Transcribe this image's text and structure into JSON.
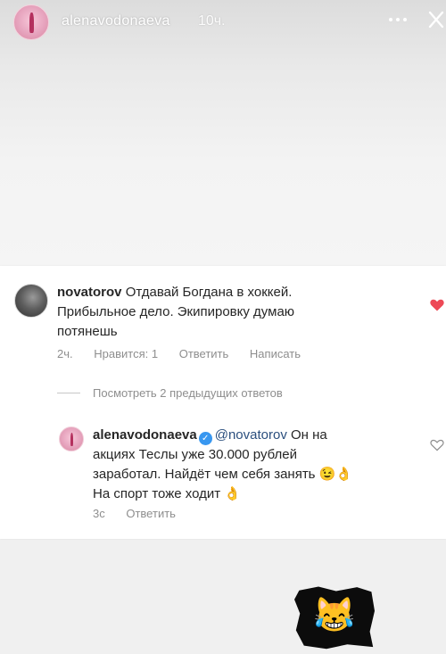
{
  "story": {
    "username": "alenavodonaeva",
    "time": "10ч.",
    "more_icon": "more-dots-icon",
    "close_icon": "close-icon"
  },
  "comment": {
    "username": "novatorov",
    "text_line1": "Отдавай Богдана в хоккей.",
    "text_line2": "Прибыльное дело. Экипировку думаю",
    "text_line3": "потянешь",
    "time": "2ч.",
    "likes": "Нравится: 1",
    "reply": "Ответить",
    "message": "Написать",
    "liked": true
  },
  "view_previous": "Посмотреть 2 предыдущих ответов",
  "reply": {
    "username": "alenavodonaeva",
    "mention": "@novatorov",
    "text_line1_tail": "Он на",
    "text_line2": "акциях Теслы уже 30.000 рублей",
    "text_line3": "заработал. Найдёт чем себя занять",
    "text_line3_emoji": "😉👌",
    "text_line4": "На спорт тоже ходит",
    "text_line4_emoji": "👌",
    "time": "3с",
    "reply_label": "Ответить"
  },
  "sticker": {
    "emoji": "😹",
    "icon": "crying-laughing-cat-sticker"
  },
  "colors": {
    "heart_red": "#ed4956",
    "verified_blue": "#3897f0",
    "mention_blue": "#2b4f7e",
    "meta_gray": "#8e8e8e"
  }
}
